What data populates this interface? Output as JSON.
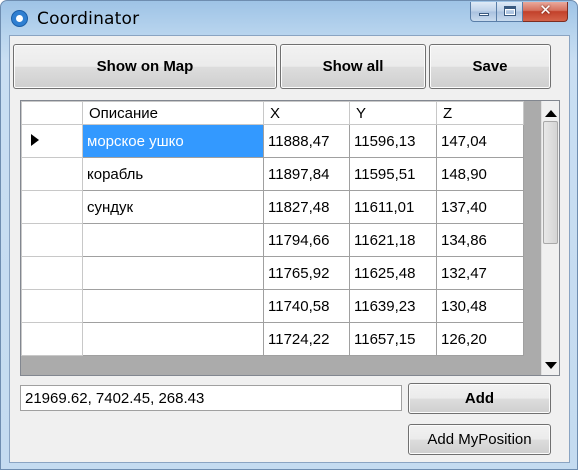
{
  "window": {
    "title": "Coordinator"
  },
  "toolbar": {
    "show_on_map": "Show on Map",
    "show_all": "Show all",
    "save": "Save"
  },
  "grid": {
    "columns": [
      "Описание",
      "X",
      "Y",
      "Z"
    ],
    "rows": [
      {
        "desc": "морское ушко",
        "x": "11888,47",
        "y": "11596,13",
        "z": "147,04",
        "current": true
      },
      {
        "desc": "корабль",
        "x": "11897,84",
        "y": "11595,51",
        "z": "148,90"
      },
      {
        "desc": "сундук",
        "x": "11827,48",
        "y": "11611,01",
        "z": "137,40"
      },
      {
        "desc": "",
        "x": "11794,66",
        "y": "11621,18",
        "z": "134,86"
      },
      {
        "desc": "",
        "x": "11765,92",
        "y": "11625,48",
        "z": "132,47"
      },
      {
        "desc": "",
        "x": "11740,58",
        "y": "11639,23",
        "z": "130,48"
      },
      {
        "desc": "",
        "x": "11724,22",
        "y": "11657,15",
        "z": "126,20"
      }
    ]
  },
  "input": {
    "value": "21969.62, 7402.45, 268.43"
  },
  "actions": {
    "add": "Add",
    "add_my_position": "Add MyPosition"
  },
  "colors": {
    "selection": "#3399ff"
  }
}
